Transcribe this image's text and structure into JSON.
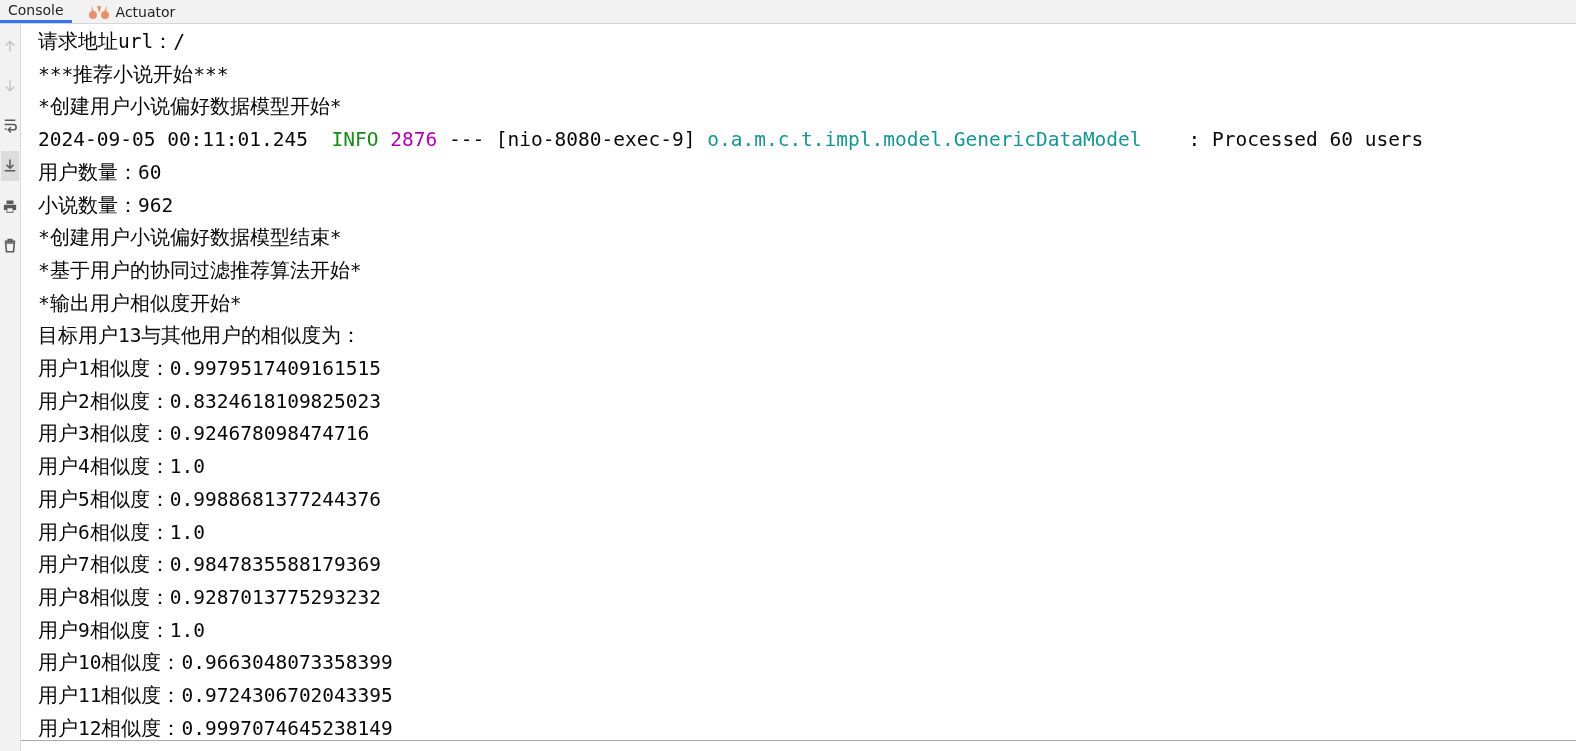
{
  "tabs": [
    {
      "label": "Console",
      "kind": "plain",
      "selected": true
    },
    {
      "label": "Actuator",
      "kind": "actuator",
      "selected": false
    }
  ],
  "toolbar": [
    {
      "kind": "up",
      "disabled": true,
      "selected": false
    },
    {
      "kind": "down",
      "disabled": true,
      "selected": false
    },
    {
      "kind": "wrap",
      "disabled": false,
      "selected": false
    },
    {
      "kind": "scroll-end",
      "disabled": false,
      "selected": true
    },
    {
      "kind": "print",
      "disabled": false,
      "selected": false
    },
    {
      "kind": "trash",
      "disabled": false,
      "selected": false
    }
  ],
  "console_lines": [
    [
      {
        "kind": "plain",
        "text": "请求地址url：/"
      }
    ],
    [
      {
        "kind": "plain",
        "text": "***推荐小说开始***"
      }
    ],
    [
      {
        "kind": "plain",
        "text": "*创建用户小说偏好数据模型开始*"
      }
    ],
    [
      {
        "kind": "plain",
        "text": "2024-09-05 00:11:01.245  "
      },
      {
        "kind": "level",
        "text": "INFO"
      },
      {
        "kind": "pid",
        "text": "2876"
      },
      {
        "kind": "plain",
        "text": " --- [nio-8080-exec-9] "
      },
      {
        "kind": "logger",
        "text": "o.a.m.c.t.impl.model.GenericDataModel"
      },
      {
        "kind": "plain",
        "text": "    : Processed 60 users"
      }
    ],
    [
      {
        "kind": "plain",
        "text": "用户数量：60"
      }
    ],
    [
      {
        "kind": "plain",
        "text": "小说数量：962"
      }
    ],
    [
      {
        "kind": "plain",
        "text": "*创建用户小说偏好数据模型结束*"
      }
    ],
    [
      {
        "kind": "plain",
        "text": "*基于用户的协同过滤推荐算法开始*"
      }
    ],
    [
      {
        "kind": "plain",
        "text": "*输出用户相似度开始*"
      }
    ],
    [
      {
        "kind": "plain",
        "text": "目标用户13与其他用户的相似度为："
      }
    ],
    [
      {
        "kind": "plain",
        "text": "用户1相似度：0.9979517409161515"
      }
    ],
    [
      {
        "kind": "plain",
        "text": "用户2相似度：0.8324618109825023"
      }
    ],
    [
      {
        "kind": "plain",
        "text": "用户3相似度：0.924678098474716"
      }
    ],
    [
      {
        "kind": "plain",
        "text": "用户4相似度：1.0"
      }
    ],
    [
      {
        "kind": "plain",
        "text": "用户5相似度：0.9988681377244376"
      }
    ],
    [
      {
        "kind": "plain",
        "text": "用户6相似度：1.0"
      }
    ],
    [
      {
        "kind": "plain",
        "text": "用户7相似度：0.9847835588179369"
      }
    ],
    [
      {
        "kind": "plain",
        "text": "用户8相似度：0.9287013775293232"
      }
    ],
    [
      {
        "kind": "plain",
        "text": "用户9相似度：1.0"
      }
    ],
    [
      {
        "kind": "plain",
        "text": "用户10相似度：0.9663048073358399"
      }
    ],
    [
      {
        "kind": "plain",
        "text": "用户11相似度：0.9724306702043395"
      }
    ],
    [
      {
        "kind": "plain",
        "text": "用户12相似度：0.9997074645238149"
      }
    ]
  ]
}
